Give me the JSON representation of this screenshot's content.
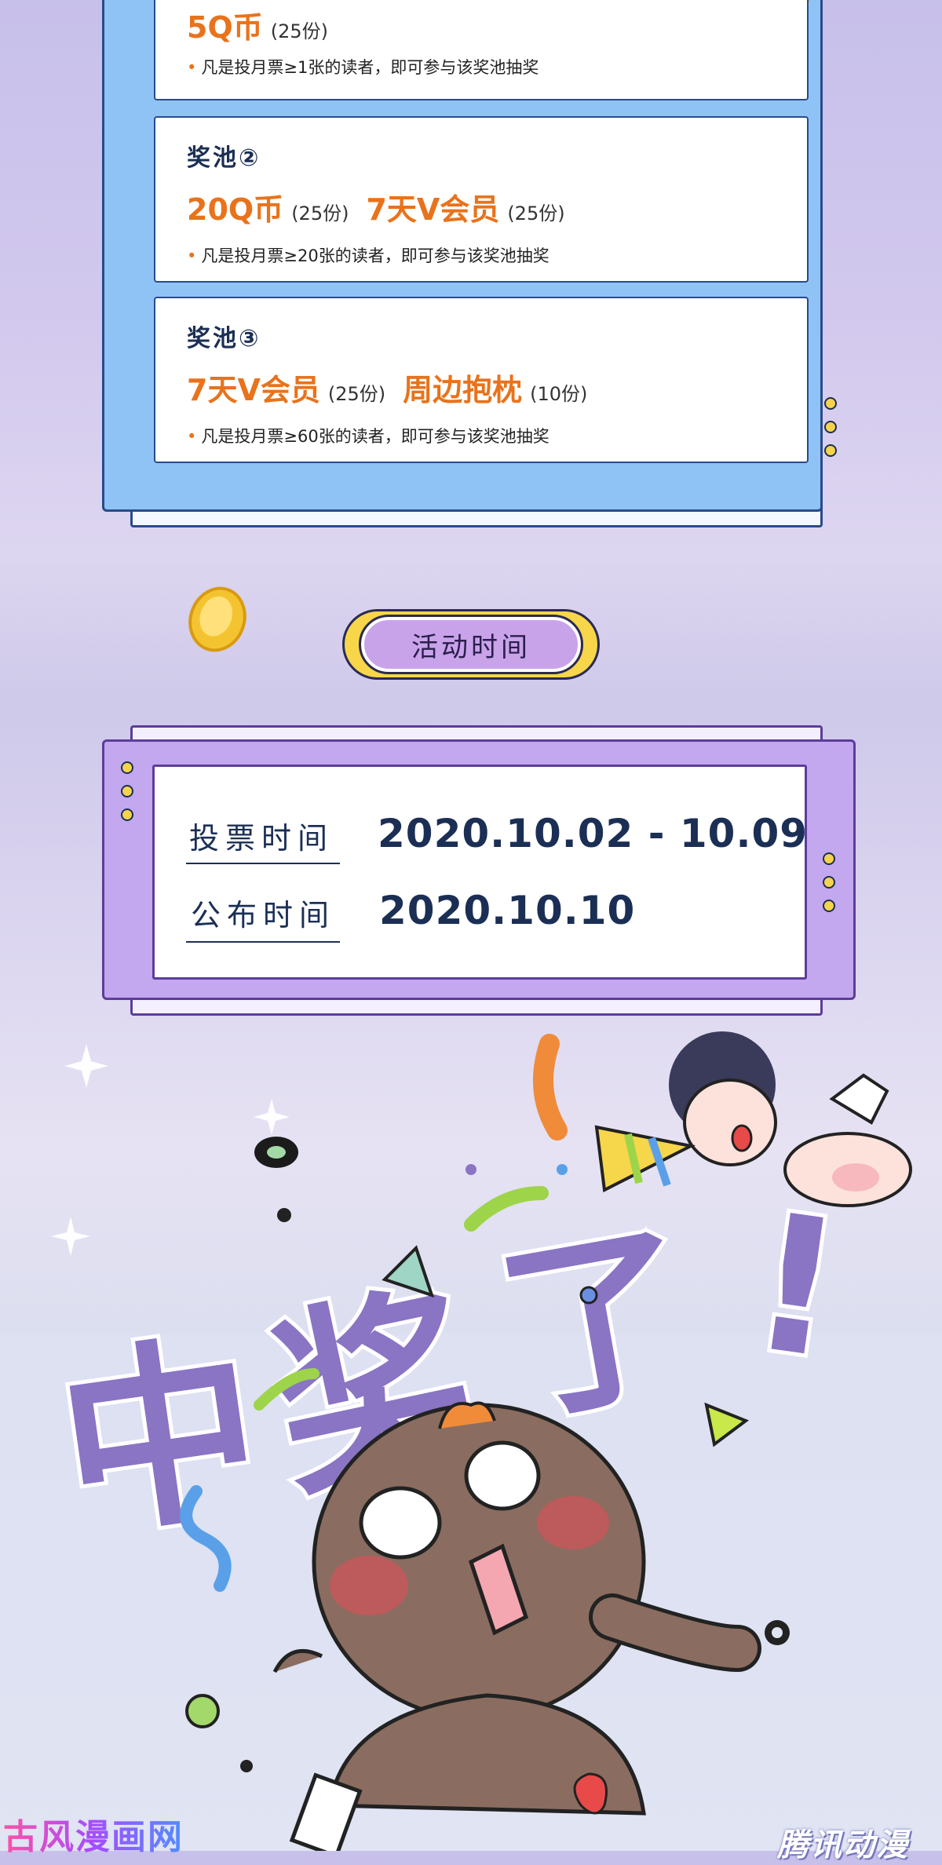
{
  "pools": [
    {
      "title": "",
      "prizes": [
        {
          "name": "5Q币",
          "qty": "(25份)"
        }
      ],
      "note": "凡是投月票≥1张的读者，即可参与该奖池抽奖"
    },
    {
      "title": "奖池②",
      "prizes": [
        {
          "name": "20Q币",
          "qty": "(25份)"
        },
        {
          "name": "7天V会员",
          "qty": "(25份)"
        }
      ],
      "note": "凡是投月票≥20张的读者，即可参与该奖池抽奖"
    },
    {
      "title": "奖池③",
      "prizes": [
        {
          "name": "7天V会员",
          "qty": "(25份)"
        },
        {
          "name": "周边抱枕",
          "qty": "(10份)"
        }
      ],
      "note": "凡是投月票≥60张的读者，即可参与该奖池抽奖"
    }
  ],
  "section": {
    "time_heading": "活动时间"
  },
  "schedule": {
    "vote_label": "投票时间",
    "vote_value": "2020.10.02 - 10.09",
    "announce_label": "公布时间",
    "announce_value": "2020.10.10"
  },
  "illustration": {
    "banner_text": "中奖了!"
  },
  "watermarks": {
    "left": "古风漫画网",
    "right": "腾讯动漫"
  },
  "colors": {
    "pool_panel": "#8fc3f5",
    "time_panel": "#c3a7ef",
    "prize_orange": "#e8731c",
    "navy": "#1b2f55",
    "pill_purple": "#c9a3ea",
    "pill_yellow": "#f7d64a"
  }
}
